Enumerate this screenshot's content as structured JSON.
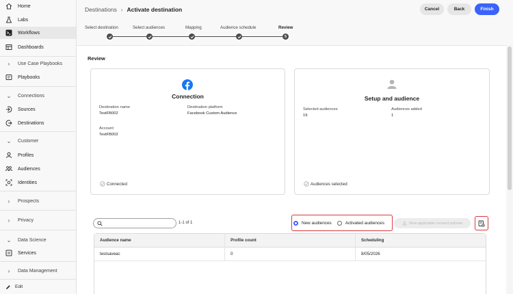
{
  "sidebar": {
    "items": [
      {
        "label": "Home",
        "icon": "home-icon"
      },
      {
        "label": "Labs",
        "icon": "labs-icon"
      },
      {
        "label": "Workflows",
        "icon": "workflows-icon"
      },
      {
        "label": "Dashboards",
        "icon": "dashboards-icon"
      },
      {
        "label": "Use Case Playbooks",
        "icon": "chevron-right-icon"
      },
      {
        "label": "Playbooks",
        "icon": "playbooks-icon"
      },
      {
        "label": "Connections",
        "icon": "chevron-down-icon"
      },
      {
        "label": "Sources",
        "icon": "sources-icon"
      },
      {
        "label": "Destinations",
        "icon": "destinations-icon"
      },
      {
        "label": "Customer",
        "icon": "chevron-down-icon"
      },
      {
        "label": "Profiles",
        "icon": "profiles-icon"
      },
      {
        "label": "Audiences",
        "icon": "audiences-icon"
      },
      {
        "label": "Identities",
        "icon": "identities-icon"
      },
      {
        "label": "Prospects",
        "icon": "chevron-right-icon"
      },
      {
        "label": "Privacy",
        "icon": "chevron-right-icon"
      },
      {
        "label": "Data Science",
        "icon": "chevron-down-icon"
      },
      {
        "label": "Services",
        "icon": "services-icon"
      },
      {
        "label": "Data Management",
        "icon": "chevron-right-icon"
      }
    ],
    "edit_label": "Edit"
  },
  "header": {
    "breadcrumb_parent": "Destinations",
    "breadcrumb_separator": "›",
    "breadcrumb_current": "Activate destination",
    "cancel_label": "Cancel",
    "back_label": "Back",
    "finish_label": "Finish"
  },
  "steps": [
    {
      "label": "Select destination",
      "state": "complete"
    },
    {
      "label": "Select audiences",
      "state": "complete"
    },
    {
      "label": "Mapping",
      "state": "complete"
    },
    {
      "label": "Audience schedule",
      "state": "complete"
    },
    {
      "label": "Review",
      "state": "current",
      "number": "5"
    }
  ],
  "review": {
    "title": "Review",
    "connection_card": {
      "title": "Connection",
      "destination_name_label": "Destination name",
      "destination_name_value": "TestFB002",
      "destination_platform_label": "Destination platform",
      "destination_platform_value": "Facebook Custom Audience",
      "account_label": "Account",
      "account_value": "TestFB002",
      "status": "Connected"
    },
    "audience_card": {
      "title": "Setup and audience",
      "selected_audiences_label": "Selected audiences",
      "selected_audiences_value": "19",
      "audiences_added_label": "Audiences added",
      "audiences_added_value": "1",
      "status": "Audiences selected"
    }
  },
  "toolbar": {
    "search_placeholder": "",
    "count": "1-1 of 1",
    "radio_new": "New audiences",
    "radio_activated": "Activated audiences",
    "selected_radio": "New audiences",
    "policy_button": "View applicable consent policies"
  },
  "table": {
    "columns": [
      "Audience name",
      "Profile count",
      "Scheduling"
    ],
    "rows": [
      [
        "testsaveac",
        "0",
        "8/05/2026"
      ]
    ]
  },
  "colors": {
    "accent": "#3b63fb",
    "highlight": "#d7373f",
    "facebook": "#1877f2"
  }
}
